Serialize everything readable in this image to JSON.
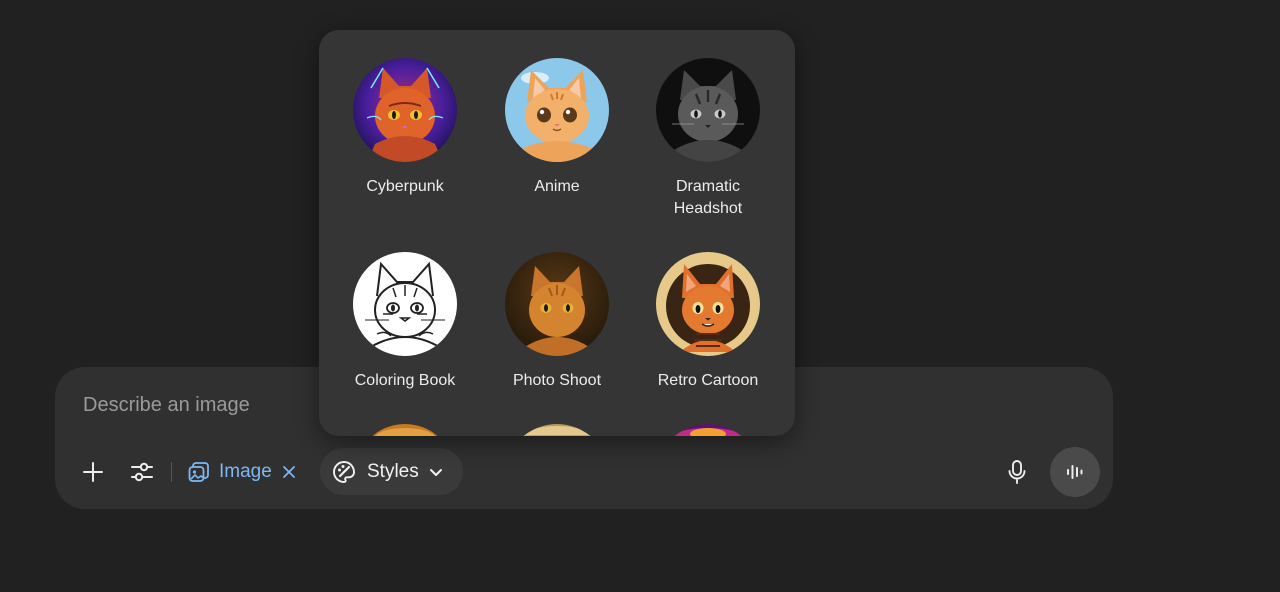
{
  "composer": {
    "placeholder": "Describe an image",
    "toolbar": {
      "plus_icon": "plus-icon",
      "tools_icon": "sliders-icon",
      "image_chip": {
        "label": "Image",
        "icon": "image-icon",
        "accent": "#7db8f2"
      },
      "styles_button": {
        "label": "Styles",
        "icon": "palette-icon"
      },
      "mic_icon": "microphone-icon",
      "voice_icon": "voice-waveform-icon"
    }
  },
  "styles_popup": {
    "items": [
      {
        "label": "Cyberpunk"
      },
      {
        "label": "Anime"
      },
      {
        "label": "Dramatic\nHeadshot"
      },
      {
        "label": "Coloring Book"
      },
      {
        "label": "Photo Shoot"
      },
      {
        "label": "Retro Cartoon"
      }
    ]
  }
}
